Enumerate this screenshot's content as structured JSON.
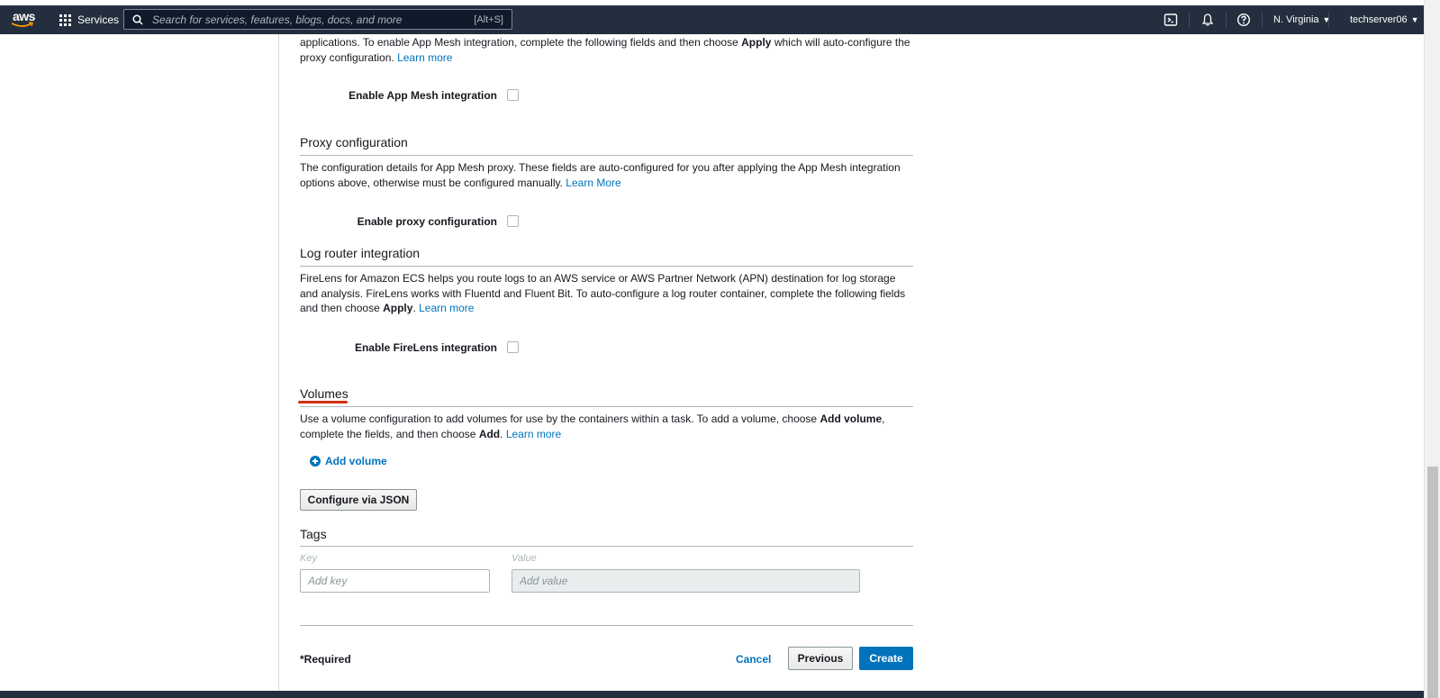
{
  "nav": {
    "services": "Services",
    "search_placeholder": "Search for services, features, blogs, docs, and more",
    "search_shortcut": "[Alt+S]",
    "region": "N. Virginia",
    "account": "techserver06"
  },
  "appmesh": {
    "text": "applications. To enable App Mesh integration, complete the following fields and then choose",
    "bold": "Apply",
    "text2": "which will auto-configure the proxy configuration.",
    "learn_more": "Learn more",
    "checkbox_label": "Enable App Mesh integration"
  },
  "proxy": {
    "title": "Proxy configuration",
    "text": "The configuration details for App Mesh proxy. These fields are auto-configured for you after applying the App Mesh integration options above, otherwise must be configured manually.",
    "learn_more": "Learn More",
    "checkbox_label": "Enable proxy configuration"
  },
  "logrouter": {
    "title": "Log router integration",
    "text": "FireLens for Amazon ECS helps you route logs to an AWS service or AWS Partner Network (APN) destination for log storage and analysis. FireLens works with Fluentd and Fluent Bit. To auto-configure a log router container, complete the following fields and then choose",
    "bold": "Apply",
    "learn_more": "Learn more",
    "checkbox_label": "Enable FireLens integration"
  },
  "volumes": {
    "title": "Volumes",
    "text1": "Use a volume configuration to add volumes for use by the containers within a task. To add a volume, choose",
    "bold1": "Add volume",
    "text2": ", complete the fields, and then choose",
    "bold2": "Add",
    "learn_more": "Learn more",
    "add_label": "Add volume",
    "json_button": "Configure via JSON"
  },
  "tags": {
    "title": "Tags",
    "key_label": "Key",
    "value_label": "Value",
    "key_placeholder": "Add key",
    "value_placeholder": "Add value"
  },
  "footer": {
    "required": "*Required",
    "cancel": "Cancel",
    "previous": "Previous",
    "create": "Create"
  },
  "colors": {
    "nav_bg": "#232f3e",
    "link": "#0073bb",
    "primary": "#0073bb",
    "annotation": "#d13212"
  }
}
